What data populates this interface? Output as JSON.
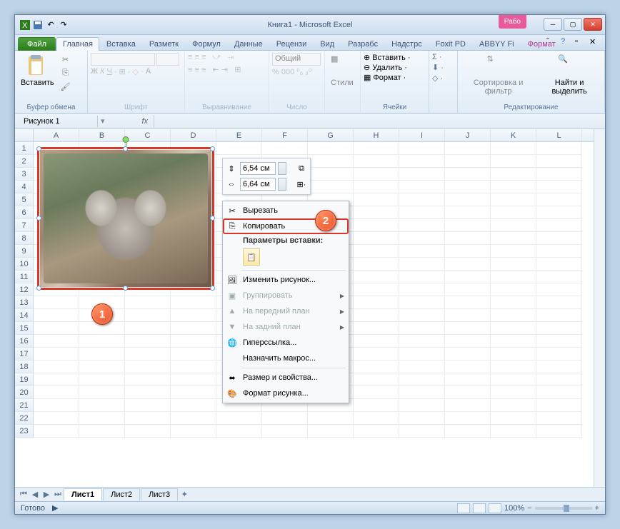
{
  "title": "Книга1 - Microsoft Excel",
  "work_badge": "Рабо",
  "tabs": {
    "file": "Файл",
    "home": "Главная",
    "insert": "Вставка",
    "layout": "Разметк",
    "formulas": "Формул",
    "data": "Данные",
    "review": "Рецензи",
    "view": "Вид",
    "developer": "Разрабс",
    "addins": "Надстрс",
    "foxit": "Foxit PD",
    "abbyy": "ABBYY Fi",
    "format": "Формат"
  },
  "ribbon": {
    "paste": "Вставить",
    "clipboard": "Буфер обмена",
    "font_group": "Шрифт",
    "align_group": "Выравнивание",
    "number_group": "Число",
    "number_format": "Общий",
    "styles": "Стили",
    "cells_group": "Ячейки",
    "cells_insert": "Вставить",
    "cells_delete": "Удалить",
    "cells_format": "Формат",
    "sort_filter": "Сортировка и фильтр",
    "find_select": "Найти и выделить",
    "editing_group": "Редактирование"
  },
  "namebox": "Рисунок 1",
  "fx": "fx",
  "columns": [
    "A",
    "B",
    "C",
    "D",
    "E",
    "F",
    "G",
    "H",
    "I",
    "J",
    "K",
    "L"
  ],
  "rows": [
    "1",
    "2",
    "3",
    "4",
    "5",
    "6",
    "7",
    "8",
    "9",
    "10",
    "11",
    "12",
    "13",
    "14",
    "15",
    "16",
    "17",
    "18",
    "19",
    "20",
    "21",
    "22",
    "23"
  ],
  "mini": {
    "height": "6,54 см",
    "width": "6,64 см"
  },
  "context": {
    "cut": "Вырезать",
    "copy": "Копировать",
    "paste_options": "Параметры вставки:",
    "change_picture": "Изменить рисунок...",
    "group": "Группировать",
    "bring_front": "На передний план",
    "send_back": "На задний план",
    "hyperlink": "Гиперссылка...",
    "assign_macro": "Назначить макрос...",
    "size_props": "Размер и свойства...",
    "format_picture": "Формат рисунка..."
  },
  "callouts": {
    "one": "1",
    "two": "2"
  },
  "sheets": {
    "s1": "Лист1",
    "s2": "Лист2",
    "s3": "Лист3"
  },
  "status": {
    "ready": "Готово",
    "zoom": "100%"
  }
}
